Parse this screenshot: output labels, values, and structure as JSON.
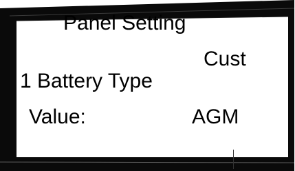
{
  "panel": {
    "title": "Panel Setting",
    "mode": "Cust",
    "item_label": "1 Battery Type",
    "value_label": "Value:",
    "value": "AGM"
  },
  "colors": {
    "bezel": "#0a0a0a",
    "screen": "#ffffff",
    "text": "#000000"
  }
}
